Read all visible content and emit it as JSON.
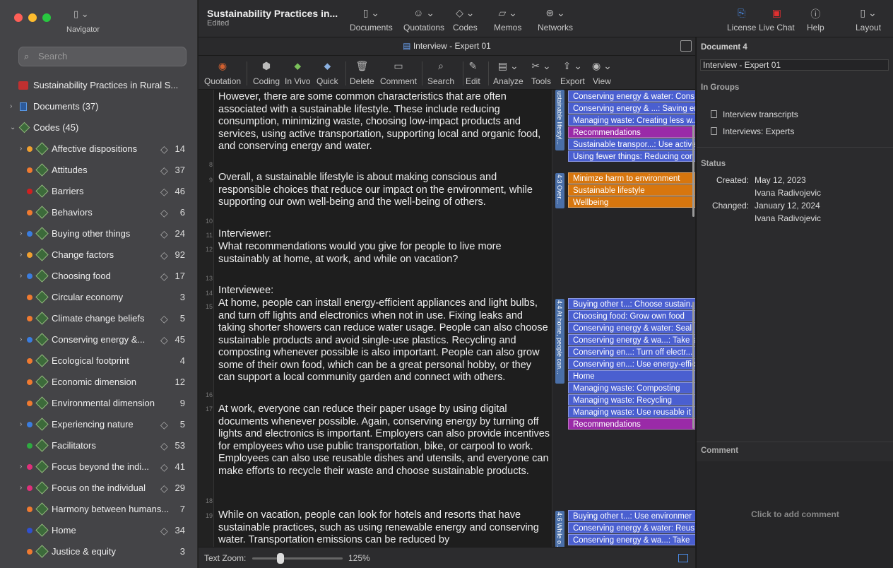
{
  "navigator": {
    "label": "Navigator",
    "search_placeholder": "Search"
  },
  "project": {
    "title": "Sustainability Practices in...",
    "status": "Edited",
    "tree_title": "Sustainability Practices in Rural S..."
  },
  "tree": {
    "documents": "Documents (37)",
    "codes": "Codes (45)"
  },
  "codes": [
    {
      "name": "Affective dispositions",
      "count": "14",
      "color": "#f0a030",
      "has_children": true,
      "has_diamond": true
    },
    {
      "name": "Attitudes",
      "count": "37",
      "color": "#f07a30",
      "has_children": false,
      "has_diamond": true
    },
    {
      "name": "Barriers",
      "count": "46",
      "color": "#d02020",
      "has_children": false,
      "has_diamond": true
    },
    {
      "name": "Behaviors",
      "count": "6",
      "color": "#f07a30",
      "has_children": false,
      "has_diamond": true
    },
    {
      "name": "Buying other things",
      "count": "24",
      "color": "#3a7de0",
      "has_children": true,
      "has_diamond": true
    },
    {
      "name": "Change factors",
      "count": "92",
      "color": "#f0a030",
      "has_children": true,
      "has_diamond": true
    },
    {
      "name": "Choosing food",
      "count": "17",
      "color": "#3a7de0",
      "has_children": true,
      "has_diamond": true
    },
    {
      "name": "Circular economy",
      "count": "3",
      "color": "#f07a30",
      "has_children": false,
      "has_diamond": false
    },
    {
      "name": "Climate change beliefs",
      "count": "5",
      "color": "#f07a30",
      "has_children": false,
      "has_diamond": true
    },
    {
      "name": "Conserving energy &...",
      "count": "45",
      "color": "#3a7de0",
      "has_children": true,
      "has_diamond": true
    },
    {
      "name": "Ecological footprint",
      "count": "4",
      "color": "#f07a30",
      "has_children": false,
      "has_diamond": false
    },
    {
      "name": "Economic dimension",
      "count": "12",
      "color": "#f07a30",
      "has_children": false,
      "has_diamond": false
    },
    {
      "name": "Environmental dimension",
      "count": "9",
      "color": "#f07a30",
      "has_children": false,
      "has_diamond": false
    },
    {
      "name": "Experiencing nature",
      "count": "5",
      "color": "#3a7de0",
      "has_children": true,
      "has_diamond": true
    },
    {
      "name": "Facilitators",
      "count": "53",
      "color": "#2eaa40",
      "has_children": false,
      "has_diamond": true
    },
    {
      "name": "Focus beyond the indi...",
      "count": "41",
      "color": "#e0307a",
      "has_children": true,
      "has_diamond": true
    },
    {
      "name": "Focus on the individual",
      "count": "29",
      "color": "#e0307a",
      "has_children": true,
      "has_diamond": true
    },
    {
      "name": "Harmony between humans...",
      "count": "7",
      "color": "#f07a30",
      "has_children": false,
      "has_diamond": false
    },
    {
      "name": "Home",
      "count": "34",
      "color": "#3050d0",
      "has_children": false,
      "has_diamond": true
    },
    {
      "name": "Justice & equity",
      "count": "3",
      "color": "#f07a30",
      "has_children": false,
      "has_diamond": false
    }
  ],
  "header_buttons": [
    {
      "label": "Documents",
      "icon": "document-icon"
    },
    {
      "label": "Quotations",
      "icon": "quotation-icon"
    },
    {
      "label": "Codes",
      "icon": "code-icon"
    },
    {
      "label": "Memos",
      "icon": "memo-icon"
    },
    {
      "label": "Networks",
      "icon": "network-icon"
    },
    {
      "label": "License",
      "icon": "license-icon"
    },
    {
      "label": "Live Chat",
      "icon": "chat-icon"
    },
    {
      "label": "Help",
      "icon": "help-icon"
    },
    {
      "label": "Layout",
      "icon": "layout-icon"
    }
  ],
  "doc_tab": "Interview - Expert 01",
  "toolbar": [
    {
      "label": "Quotation"
    },
    {
      "label": "Coding"
    },
    {
      "label": "In Vivo"
    },
    {
      "label": "Quick"
    },
    {
      "label": "Delete"
    },
    {
      "label": "Comment"
    },
    {
      "label": "Search"
    },
    {
      "label": "Edit"
    },
    {
      "label": "Analyze"
    },
    {
      "label": "Tools"
    },
    {
      "label": "Export"
    },
    {
      "label": "View"
    }
  ],
  "document": {
    "lines": [
      "8",
      "9",
      "10",
      "11",
      "12",
      "13",
      "14",
      "15",
      "16",
      "17",
      "18",
      "19"
    ],
    "paragraphs": [
      "However, there are some common characteristics that are often associated with a sustainable lifestyle. These include reducing consumption, minimizing waste, choosing low-impact products and services, using active transportation, supporting local and organic food, and conserving energy and water.",
      "Overall, a sustainable lifestyle is about making conscious and responsible choices that reduce our impact on the environment, while supporting our own well-being and the well-being of others.",
      "Interviewer:",
      "What recommendations would you give for people to live more sustainably at home, at work, and while on vacation?",
      "Interviewee:",
      "At home, people can install energy-efficient appliances and light bulbs, and turn off lights and electronics when not in use. Fixing leaks and taking shorter showers can reduce water usage. People can also choose sustainable products and avoid single-use plastics. Recycling and composting whenever possible is also important. People can also grow some of their own food, which can be a great personal hobby, or they can support a local community garden and connect with others.",
      "At work, everyone can reduce their paper usage by using digital documents whenever possible. Again, conserving energy by turning off lights and electronics is important. Employers can also provide incentives for employees who use public transportation, bike, or carpool to work. Employees can also use reusable dishes and utensils, and everyone can make efforts to recycle their waste and choose sustainable products.",
      "While on vacation, people can look for hotels and resorts that have sustainable practices, such as using renewable energy and conserving water. Transportation emissions can be reduced by"
    ]
  },
  "margin": {
    "segments": [
      {
        "label": "ustainable lifestyl..."
      },
      {
        "label": "4:3 Over..."
      },
      {
        "label": "4:4 At home, people can..."
      },
      {
        "label": "4:6 While o..."
      }
    ],
    "tags": [
      {
        "text": "Conserving energy & water: Cons",
        "color": "#4a5fd0"
      },
      {
        "text": "Conserving energy & ...: Saving en",
        "color": "#4a5fd0"
      },
      {
        "text": "Managing waste: Creating less w...",
        "color": "#4a5fd0"
      },
      {
        "text": "Recommendations",
        "color": "#9a2aa8"
      },
      {
        "text": "Sustainable transpor...: Use active",
        "color": "#4a5fd0"
      },
      {
        "text": "Using fewer things: Reducing con",
        "color": "#4a5fd0"
      },
      {
        "text": "Minimze harm to environment",
        "color": "#d7760e"
      },
      {
        "text": "Sustainable lifestyle",
        "color": "#d7760e"
      },
      {
        "text": "Wellbeing",
        "color": "#d7760e"
      },
      {
        "text": "Buying other t...: Choose sustain...",
        "color": "#4a5fd0"
      },
      {
        "text": "Choosing food: Grow own food",
        "color": "#4a5fd0"
      },
      {
        "text": "Conserving energy & water: Seal",
        "color": "#4a5fd0"
      },
      {
        "text": "Conserving energy & wa...: Take s",
        "color": "#4a5fd0"
      },
      {
        "text": "Conserving en...: Turn off electr...",
        "color": "#4a5fd0"
      },
      {
        "text": "Conserving en...: Use energy-effic",
        "color": "#4a5fd0"
      },
      {
        "text": "Home",
        "color": "#4a5fd0"
      },
      {
        "text": "Managing waste: Composting",
        "color": "#4a5fd0"
      },
      {
        "text": "Managing waste: Recycling",
        "color": "#4a5fd0"
      },
      {
        "text": "Managing waste: Use reusable it",
        "color": "#4a5fd0"
      },
      {
        "text": "Recommendations",
        "color": "#9a2aa8"
      },
      {
        "text": "Buying other t...: Use environmer",
        "color": "#4a5fd0"
      },
      {
        "text": "Conserving energy & water: Reus",
        "color": "#4a5fd0"
      },
      {
        "text": "Conserving energy & wa...: Take",
        "color": "#4a5fd0"
      }
    ]
  },
  "bottom": {
    "zoom_label": "Text Zoom:",
    "zoom_value": "125%",
    "zoom_level": 0.3
  },
  "inspector": {
    "title": "Document 4",
    "doc_name": "Interview - Expert 01",
    "groups_title": "In Groups",
    "groups": [
      "Interview transcripts",
      "Interviews: Experts"
    ],
    "status_title": "Status",
    "created_label": "Created:",
    "created_date": "May 12, 2023",
    "created_by": "Ivana Radivojevic",
    "changed_label": "Changed:",
    "changed_date": "January 12, 2024",
    "changed_by": "Ivana Radivojevic",
    "comment_title": "Comment",
    "add_comment": "Click to add comment"
  }
}
